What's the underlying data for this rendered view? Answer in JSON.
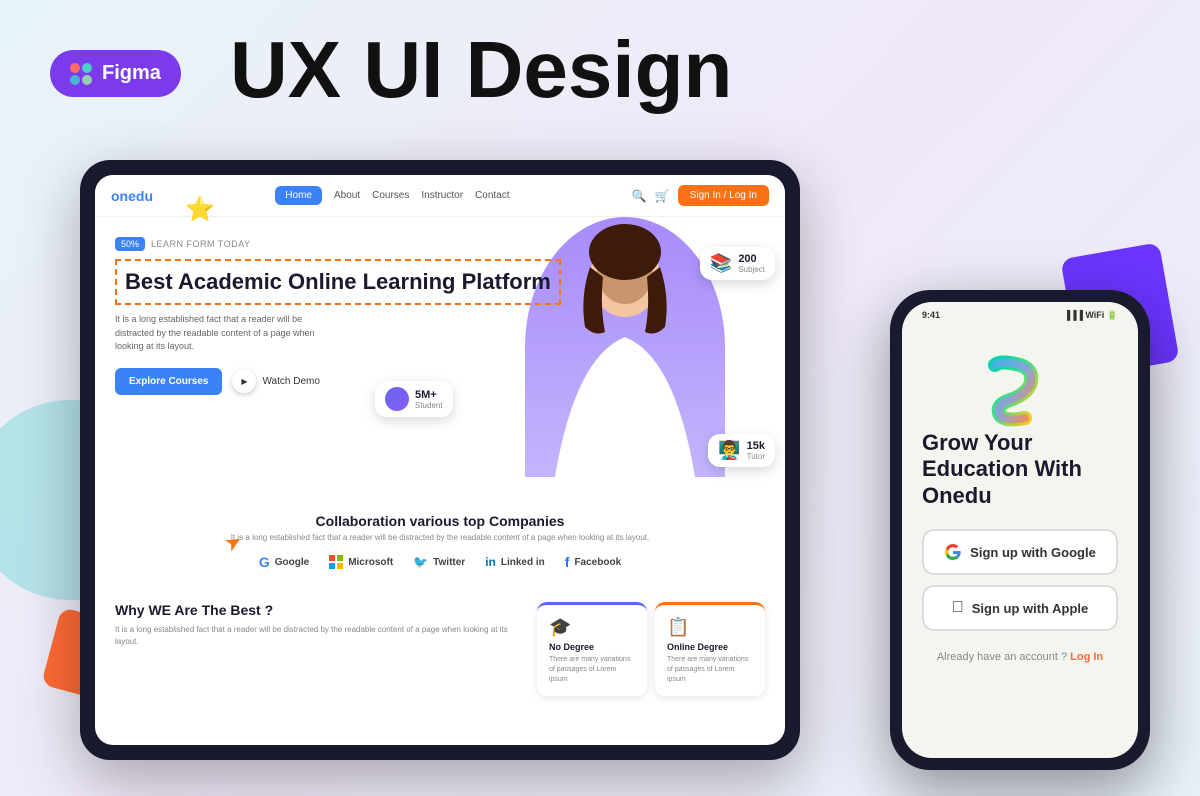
{
  "page": {
    "bg_title": "UX UI Design",
    "figma_badge": "Figma"
  },
  "tablet": {
    "logo": "onedu",
    "nav": {
      "home": "Home",
      "about": "About",
      "courses": "Courses",
      "instructor": "Instructor",
      "contact": "Contact",
      "signin": "Sign In / Log In"
    },
    "hero": {
      "badge_50": "50%",
      "badge_learn": "LEARN FORM TODAY",
      "headline": "Best Academic Online Learning Platform",
      "subtext": "It is a long established fact that a reader will be distracted by the readable content of a page when looking at its layout.",
      "btn_explore": "Explore Courses",
      "btn_watch": "Watch Demo",
      "stat_students_num": "5M+",
      "stat_students_label": "Student",
      "stat_subjects_num": "200",
      "stat_subjects_label": "Subject",
      "stat_tutor_num": "15k",
      "stat_tutor_label": "Tutor"
    },
    "companies": {
      "title": "Collaboration various top Companies",
      "subtext": "It is a long established fact that a reader will be distracted by the readable content of a page when looking at its layout.",
      "items": [
        "Google",
        "Microsoft",
        "Twitter",
        "Linked in",
        "Facebook"
      ]
    },
    "why": {
      "title": "Why WE Are The Best ?",
      "subtext": "It is a long established fact that a reader will be distracted by the readable content of a page when looking at its layout.",
      "card_no_degree_title": "No Degree",
      "card_no_degree_text": "There are many variations of passages of Lorem ipsum",
      "card_online_title": "Online Degree",
      "card_online_text": "There are many variations of passages of Lorem ipsum"
    }
  },
  "phone": {
    "time": "9:41",
    "tagline": "Grow Your Education With Onedu",
    "btn_google": "Sign up with Google",
    "btn_apple": "Sign up with Apple",
    "footer_text": "Already have an account ?",
    "footer_link": "Log In"
  }
}
